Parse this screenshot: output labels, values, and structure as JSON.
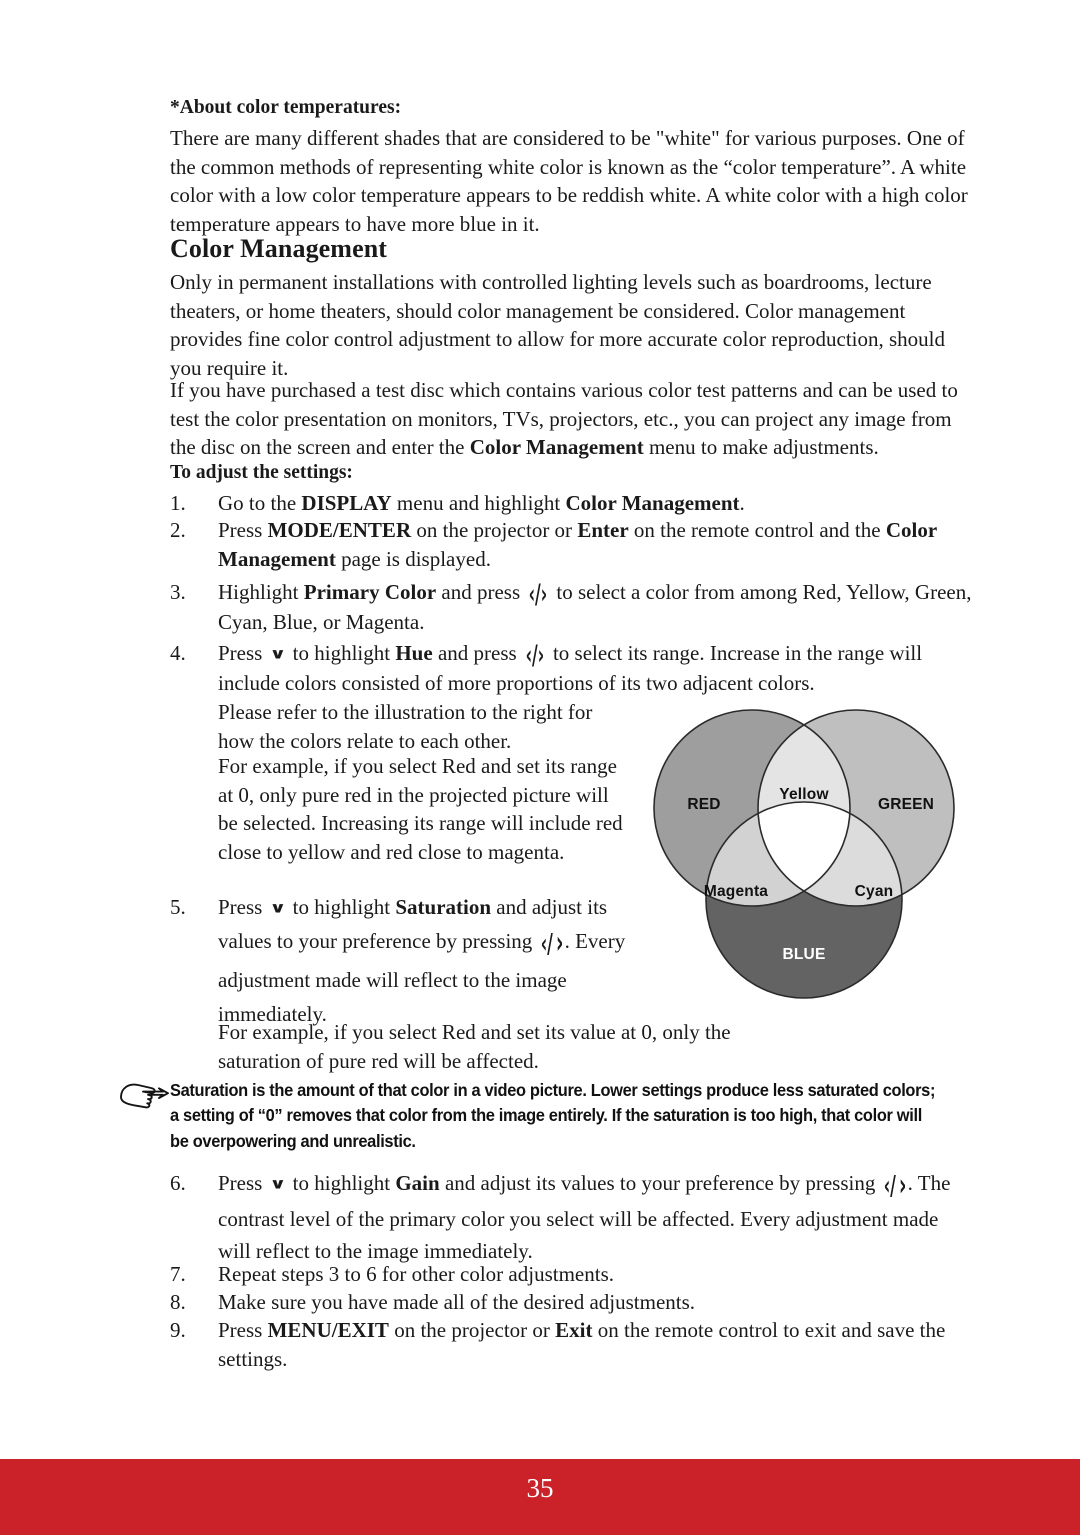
{
  "page": {
    "folio": "35",
    "footer_color": "#cb2229"
  },
  "sections": {
    "color_temp_heading": "*About color temperatures:",
    "color_temp_body": "There are many different shades that are considered to be \"white\" for various purposes. One of the common methods of representing white color is known as the “color temperature”. A white color with a low color temperature appears to be reddish white. A white color with a high color temperature appears to have more blue in it.",
    "title": "Color Management",
    "intro_1": "Only in permanent installations with controlled lighting levels such as boardrooms, lecture theaters, or home theaters, should color management be considered. Color management provides fine color control adjustment to allow for more accurate color reproduction, should you require it.",
    "intro_2_a": "If you have purchased a test disc which contains various color test patterns and can be used to test the color presentation on monitors, TVs, projectors, etc., you can project any image from the disc on the screen and enter the ",
    "intro_2_bold": "Color Management",
    "intro_2_b": " menu to make adjustments.",
    "adjust_heading": "To adjust the settings:"
  },
  "steps": {
    "s1": {
      "num": "1.",
      "a": "Go to the ",
      "bold1": "DISPLAY",
      "b": " menu and highlight ",
      "bold2": "Color Management",
      "c": "."
    },
    "s2": {
      "num": "2.",
      "a": "Press ",
      "bold1": "MODE/ENTER",
      "b": " on the projector or ",
      "bold2": "Enter",
      "c": " on the remote control and the ",
      "bold3": "Color Management",
      "d": " page is displayed."
    },
    "s3": {
      "num": "3.",
      "a": "Highlight ",
      "bold1": "Primary Color",
      "b": " and press ",
      "key": "‹/›",
      "c": " to select a color from among Red, Yellow, Green, Cyan, Blue, or Magenta."
    },
    "s4": {
      "num": "4.",
      "a": "Press ",
      "keydown": "∨",
      "b": " to highlight ",
      "bold1": "Hue",
      "c": " and press ",
      "key": "‹/›",
      "d": " to select its range. Increase in the range will include colors consisted of more proportions of its two adjacent colors.",
      "p2": "Please refer to the illustration to the right for how the colors relate to each other.",
      "p3": "For example, if you select Red and set its range at 0, only pure red in the projected picture will be selected. Increasing its range will include red close to yellow and red close to magenta."
    },
    "s5": {
      "num": "5.",
      "a": "Press ",
      "keydown": "∨",
      "b": " to highlight ",
      "bold1": "Saturation",
      "c": " and adjust its values to your preference by pressing ",
      "key_left": "‹/",
      "key_right": "›",
      "d": ". Every adjustment made will reflect to the image immediately.",
      "p2": "For example, if you select Red and set its value at 0, only the saturation of pure red will be affected."
    },
    "s6": {
      "num": "6.",
      "a": "Press ",
      "keydown": "∨",
      "b": " to highlight ",
      "bold1": "Gain",
      "c": " and adjust its values to your preference by pressing ",
      "key_left": "‹/",
      "key_right": "›",
      "d": ". The contrast level of the primary color you select will be affected. Every adjustment made will reflect to the image immediately."
    },
    "s7": {
      "num": "7.",
      "a": "Repeat steps 3 to 6 for other color adjustments."
    },
    "s8": {
      "num": "8.",
      "a": "Make sure you have made all of the desired adjustments."
    },
    "s9": {
      "num": "9.",
      "a": "Press ",
      "bold1": "MENU/EXIT",
      "b": " on the projector or ",
      "bold2": "Exit",
      "c": " on the remote control to exit and save the settings."
    }
  },
  "note": {
    "icon": "pointing-hand-icon",
    "text": "Saturation is the amount of that color in a video picture. Lower settings produce less saturated colors; a setting of “0” removes that color from the image entirely. If the saturation is too high, that color will be overpowering and unrealistic."
  },
  "venn": {
    "labels": {
      "red": "RED",
      "green": "GREEN",
      "blue": "BLUE",
      "yellow": "Yellow",
      "magenta": "Magenta",
      "cyan": "Cyan"
    },
    "colors": {
      "red": "#9e9e9e",
      "green": "#bfbfbf",
      "blue": "#636363",
      "yellow": "#e4e4e4",
      "magenta": "#d2d2d2",
      "cyan": "#dcdcdc",
      "center": "#ffffff",
      "stroke": "#2b2b2b"
    }
  }
}
